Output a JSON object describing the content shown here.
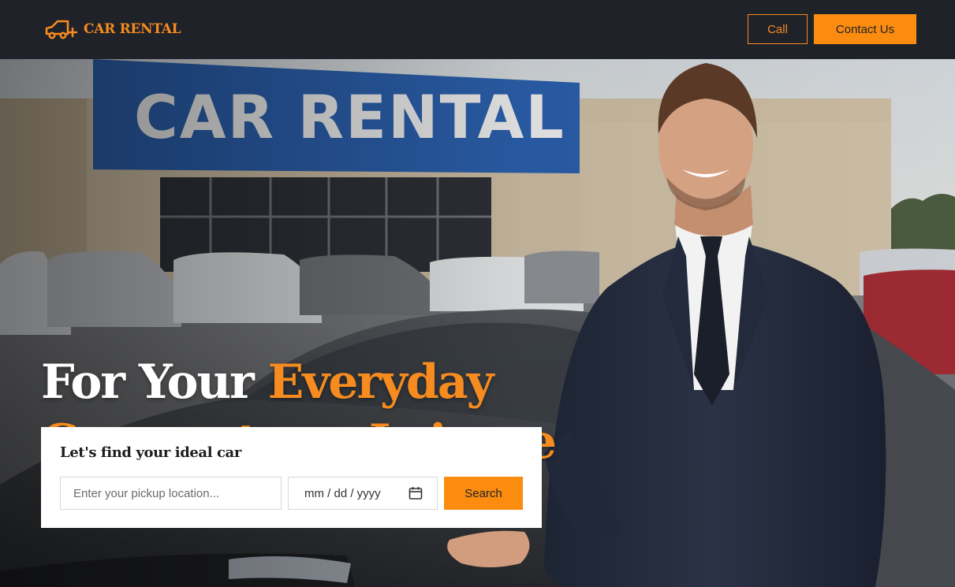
{
  "brand": {
    "name": "CAR RENTAL",
    "icon": "car-plus-icon",
    "accent_color": "#f68b1f"
  },
  "nav": {
    "call_label": "Call",
    "contact_label": "Contact Us"
  },
  "hero": {
    "image": "car-rental-agent-photo",
    "sign_text": "CAR RENTAL",
    "headline": {
      "part1": "For Your ",
      "part2": "Everyday",
      "part3": "Commute",
      "part4": " or ",
      "part5": "Leisure"
    }
  },
  "search": {
    "title": "Let's find your ideal car",
    "location_placeholder": "Enter your pickup location...",
    "date_placeholder": "mm / dd / yyyy",
    "calendar_icon": "calendar-icon",
    "button_label": "Search"
  }
}
